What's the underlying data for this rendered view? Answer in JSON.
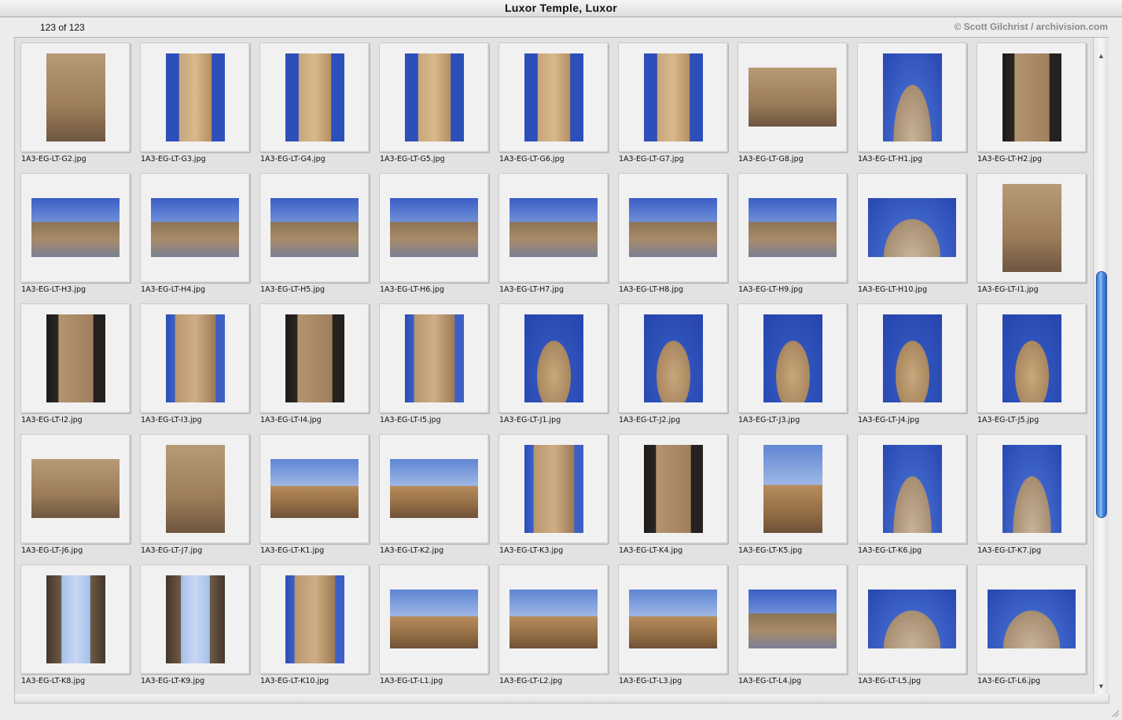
{
  "window": {
    "title": "Luxor Temple, Luxor"
  },
  "header": {
    "count": "123 of 123",
    "credit": "© Scott Gilchrist / archivision.com"
  },
  "thumbnails": [
    {
      "file": "1A3-EG-LT-G2.jpg",
      "orientation": "portrait",
      "tint": "wall"
    },
    {
      "file": "1A3-EG-LT-G3.jpg",
      "orientation": "portrait",
      "tint": "obelisk"
    },
    {
      "file": "1A3-EG-LT-G4.jpg",
      "orientation": "portrait",
      "tint": "obelisk"
    },
    {
      "file": "1A3-EG-LT-G5.jpg",
      "orientation": "portrait",
      "tint": "obelisk"
    },
    {
      "file": "1A3-EG-LT-G6.jpg",
      "orientation": "portrait",
      "tint": "obelisk"
    },
    {
      "file": "1A3-EG-LT-G7.jpg",
      "orientation": "portrait",
      "tint": "obelisk"
    },
    {
      "file": "1A3-EG-LT-G8.jpg",
      "orientation": "landscape",
      "tint": "wall"
    },
    {
      "file": "1A3-EG-LT-H1.jpg",
      "orientation": "portrait",
      "tint": "fish"
    },
    {
      "file": "1A3-EG-LT-H2.jpg",
      "orientation": "portrait",
      "tint": "dark"
    },
    {
      "file": "1A3-EG-LT-H3.jpg",
      "orientation": "landscape",
      "tint": "court"
    },
    {
      "file": "1A3-EG-LT-H4.jpg",
      "orientation": "landscape",
      "tint": "court"
    },
    {
      "file": "1A3-EG-LT-H5.jpg",
      "orientation": "landscape",
      "tint": "court"
    },
    {
      "file": "1A3-EG-LT-H6.jpg",
      "orientation": "landscape",
      "tint": "court"
    },
    {
      "file": "1A3-EG-LT-H7.jpg",
      "orientation": "landscape",
      "tint": "court"
    },
    {
      "file": "1A3-EG-LT-H8.jpg",
      "orientation": "landscape",
      "tint": "court"
    },
    {
      "file": "1A3-EG-LT-H9.jpg",
      "orientation": "landscape",
      "tint": "court"
    },
    {
      "file": "1A3-EG-LT-H10.jpg",
      "orientation": "landscape",
      "tint": "fish"
    },
    {
      "file": "1A3-EG-LT-I1.jpg",
      "orientation": "portrait",
      "tint": "wall"
    },
    {
      "file": "1A3-EG-LT-I2.jpg",
      "orientation": "portrait",
      "tint": "dark"
    },
    {
      "file": "1A3-EG-LT-I3.jpg",
      "orientation": "portrait",
      "tint": "column"
    },
    {
      "file": "1A3-EG-LT-I4.jpg",
      "orientation": "portrait",
      "tint": "dark"
    },
    {
      "file": "1A3-EG-LT-I5.jpg",
      "orientation": "portrait",
      "tint": "column"
    },
    {
      "file": "1A3-EG-LT-J1.jpg",
      "orientation": "portrait",
      "tint": "statue"
    },
    {
      "file": "1A3-EG-LT-J2.jpg",
      "orientation": "portrait",
      "tint": "statue"
    },
    {
      "file": "1A3-EG-LT-J3.jpg",
      "orientation": "portrait",
      "tint": "statue"
    },
    {
      "file": "1A3-EG-LT-J4.jpg",
      "orientation": "portrait",
      "tint": "statue"
    },
    {
      "file": "1A3-EG-LT-J5.jpg",
      "orientation": "portrait",
      "tint": "statue"
    },
    {
      "file": "1A3-EG-LT-J6.jpg",
      "orientation": "landscape",
      "tint": "wall"
    },
    {
      "file": "1A3-EG-LT-J7.jpg",
      "orientation": "portrait",
      "tint": "wall"
    },
    {
      "file": "1A3-EG-LT-K1.jpg",
      "orientation": "landscape",
      "tint": "dusk"
    },
    {
      "file": "1A3-EG-LT-K2.jpg",
      "orientation": "landscape",
      "tint": "dusk"
    },
    {
      "file": "1A3-EG-LT-K3.jpg",
      "orientation": "portrait",
      "tint": "column"
    },
    {
      "file": "1A3-EG-LT-K4.jpg",
      "orientation": "portrait",
      "tint": "dark"
    },
    {
      "file": "1A3-EG-LT-K5.jpg",
      "orientation": "portrait",
      "tint": "dusk"
    },
    {
      "file": "1A3-EG-LT-K6.jpg",
      "orientation": "portrait",
      "tint": "fish"
    },
    {
      "file": "1A3-EG-LT-K7.jpg",
      "orientation": "portrait",
      "tint": "fish"
    },
    {
      "file": "1A3-EG-LT-K8.jpg",
      "orientation": "portrait",
      "tint": "up"
    },
    {
      "file": "1A3-EG-LT-K9.jpg",
      "orientation": "portrait",
      "tint": "up"
    },
    {
      "file": "1A3-EG-LT-K10.jpg",
      "orientation": "portrait",
      "tint": "column"
    },
    {
      "file": "1A3-EG-LT-L1.jpg",
      "orientation": "landscape",
      "tint": "dusk"
    },
    {
      "file": "1A3-EG-LT-L2.jpg",
      "orientation": "landscape",
      "tint": "dusk"
    },
    {
      "file": "1A3-EG-LT-L3.jpg",
      "orientation": "landscape",
      "tint": "dusk"
    },
    {
      "file": "1A3-EG-LT-L4.jpg",
      "orientation": "landscape",
      "tint": "court"
    },
    {
      "file": "1A3-EG-LT-L5.jpg",
      "orientation": "landscape",
      "tint": "fish"
    },
    {
      "file": "1A3-EG-LT-L6.jpg",
      "orientation": "landscape",
      "tint": "fish"
    }
  ]
}
